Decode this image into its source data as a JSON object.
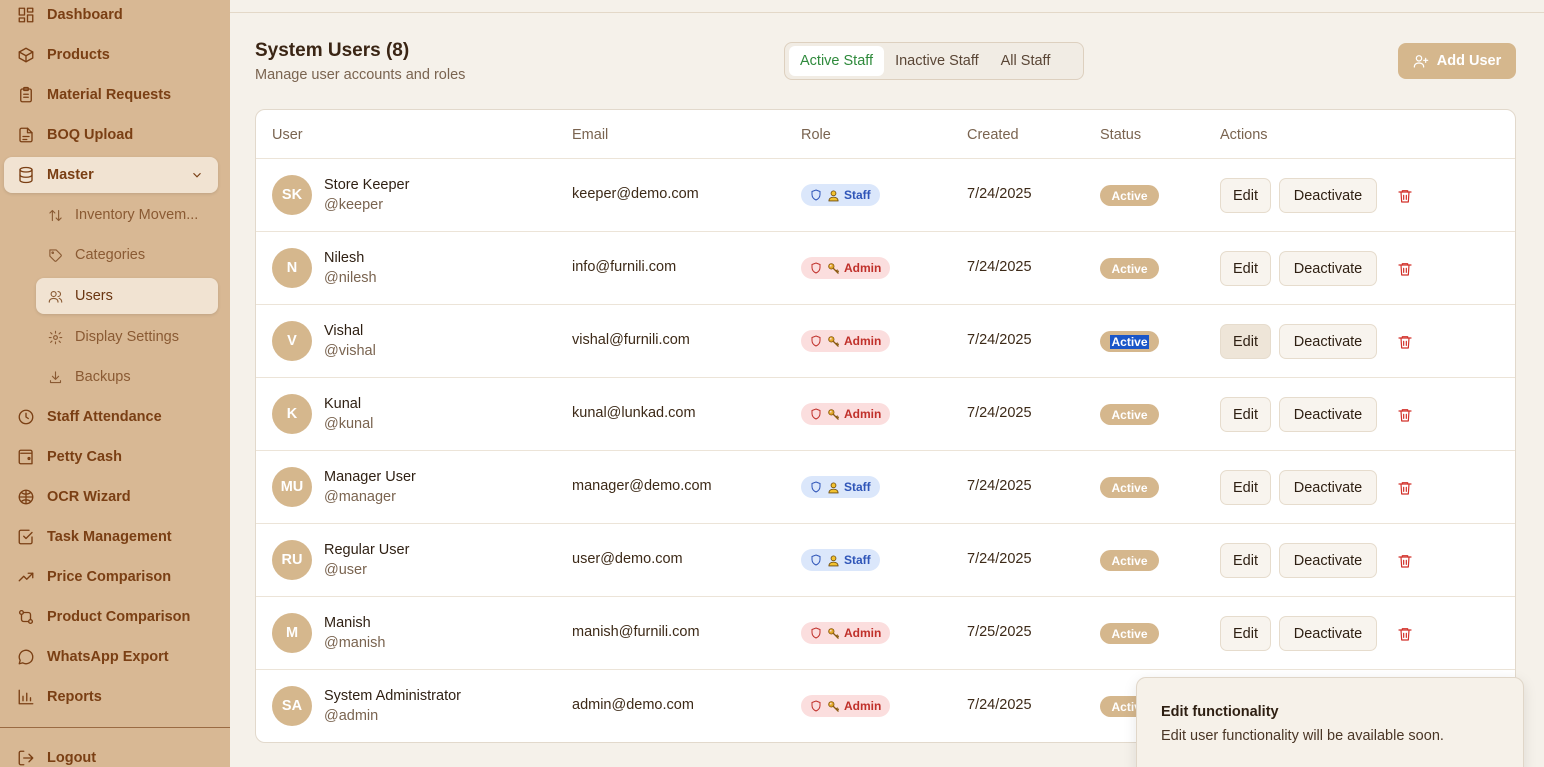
{
  "sidebar": {
    "items": [
      {
        "label": "Dashboard",
        "icon": "dashboard-icon"
      },
      {
        "label": "Products",
        "icon": "box-icon"
      },
      {
        "label": "Material Requests",
        "icon": "clipboard-icon"
      },
      {
        "label": "BOQ Upload",
        "icon": "file-upload-icon"
      },
      {
        "label": "Master",
        "icon": "database-icon"
      },
      {
        "label": "Staff Attendance",
        "icon": "clock-icon"
      },
      {
        "label": "Petty Cash",
        "icon": "wallet-icon"
      },
      {
        "label": "OCR Wizard",
        "icon": "brain-icon"
      },
      {
        "label": "Task Management",
        "icon": "check-square-icon"
      },
      {
        "label": "Price Comparison",
        "icon": "trending-up-icon"
      },
      {
        "label": "Product Comparison",
        "icon": "git-compare-icon"
      },
      {
        "label": "WhatsApp Export",
        "icon": "message-circle-icon"
      },
      {
        "label": "Reports",
        "icon": "bar-chart-icon"
      },
      {
        "label": "Logout",
        "icon": "logout-icon"
      }
    ],
    "master_sub": [
      {
        "label": "Inventory Movem...",
        "icon": "arrows-updown-icon"
      },
      {
        "label": "Categories",
        "icon": "tag-icon"
      },
      {
        "label": "Users",
        "icon": "users-icon"
      },
      {
        "label": "Display Settings",
        "icon": "gear-icon"
      },
      {
        "label": "Backups",
        "icon": "download-icon"
      }
    ]
  },
  "header": {
    "title": "System Users (8)",
    "subtitle": "Manage user accounts and roles",
    "tabs": [
      "Active Staff",
      "Inactive Staff",
      "All Staff"
    ],
    "active_tab": "Active Staff",
    "add_button": "Add User"
  },
  "table": {
    "columns": [
      "User",
      "Email",
      "Role",
      "Created",
      "Status",
      "Actions"
    ],
    "rows": [
      {
        "initials": "SK",
        "name": "Store Keeper",
        "handle": "@keeper",
        "email": "keeper@demo.com",
        "role": "Staff",
        "created": "7/24/2025",
        "status": "Active"
      },
      {
        "initials": "N",
        "name": "Nilesh",
        "handle": "@nilesh",
        "email": "info@furnili.com",
        "role": "Admin",
        "created": "7/24/2025",
        "status": "Active"
      },
      {
        "initials": "V",
        "name": "Vishal",
        "handle": "@vishal",
        "email": "vishal@furnili.com",
        "role": "Admin",
        "created": "7/24/2025",
        "status": "Active"
      },
      {
        "initials": "K",
        "name": "Kunal",
        "handle": "@kunal",
        "email": "kunal@lunkad.com",
        "role": "Admin",
        "created": "7/24/2025",
        "status": "Active"
      },
      {
        "initials": "MU",
        "name": "Manager User",
        "handle": "@manager",
        "email": "manager@demo.com",
        "role": "Staff",
        "created": "7/24/2025",
        "status": "Active"
      },
      {
        "initials": "RU",
        "name": "Regular User",
        "handle": "@user",
        "email": "user@demo.com",
        "role": "Staff",
        "created": "7/24/2025",
        "status": "Active"
      },
      {
        "initials": "M",
        "name": "Manish",
        "handle": "@manish",
        "email": "manish@furnili.com",
        "role": "Admin",
        "created": "7/25/2025",
        "status": "Active"
      },
      {
        "initials": "SA",
        "name": "System Administrator",
        "handle": "@admin",
        "email": "admin@demo.com",
        "role": "Admin",
        "created": "7/24/2025",
        "status": "Active"
      }
    ],
    "edit_label": "Edit",
    "deactivate_label": "Deactivate"
  },
  "toast": {
    "title": "Edit functionality",
    "description": "Edit user functionality will be available soon."
  },
  "colors": {
    "sidebar_bg": "#d8b894",
    "accent": "#d5b78d",
    "active_tab_text": "#2f8a3c",
    "danger": "#d2312a"
  }
}
